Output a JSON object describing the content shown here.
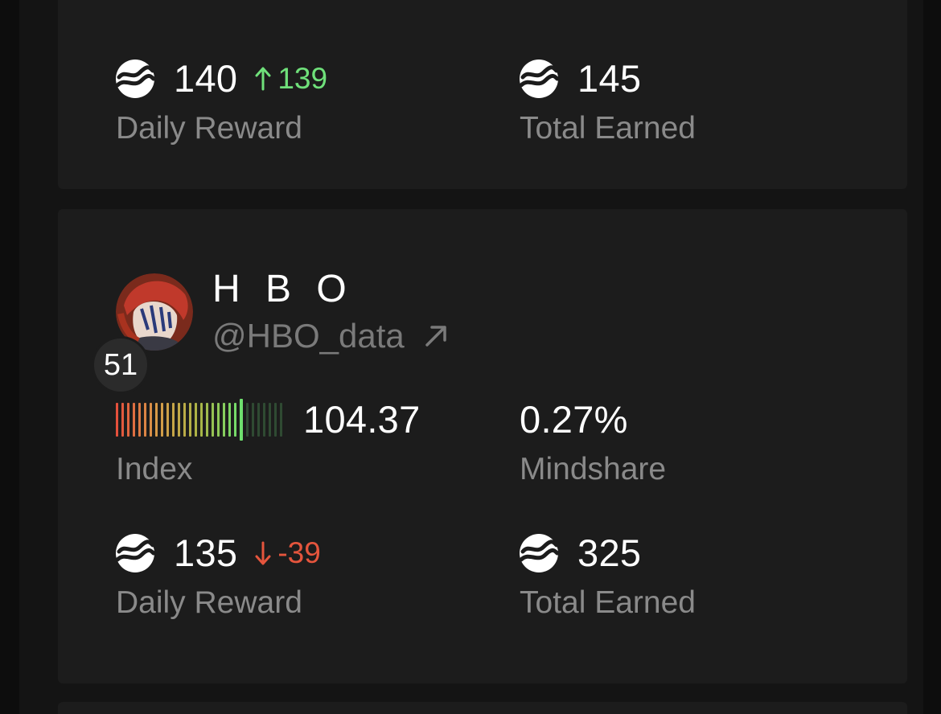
{
  "top_card": {
    "daily_reward": {
      "value": "140",
      "change": "139",
      "label": "Daily Reward"
    },
    "total_earned": {
      "value": "145",
      "label": "Total Earned"
    }
  },
  "main_card": {
    "name": "H B O",
    "handle": "@HBO_data",
    "rank": "51",
    "index": {
      "value": "104.37",
      "label": "Index",
      "level": 0.78
    },
    "mindshare": {
      "value": "0.27%",
      "label": "Mindshare"
    },
    "daily_reward": {
      "value": "135",
      "change": "-39",
      "label": "Daily Reward"
    },
    "total_earned": {
      "value": "325",
      "label": "Total Earned"
    }
  },
  "icons": {
    "coin": "coin-icon",
    "arrow_up": "arrow-up-icon",
    "arrow_down": "arrow-down-icon",
    "external_link": "external-link-icon"
  },
  "colors": {
    "positive": "#6fe07a",
    "negative": "#e5553d",
    "label": "#8a8a8a",
    "card": "#1c1c1c"
  }
}
